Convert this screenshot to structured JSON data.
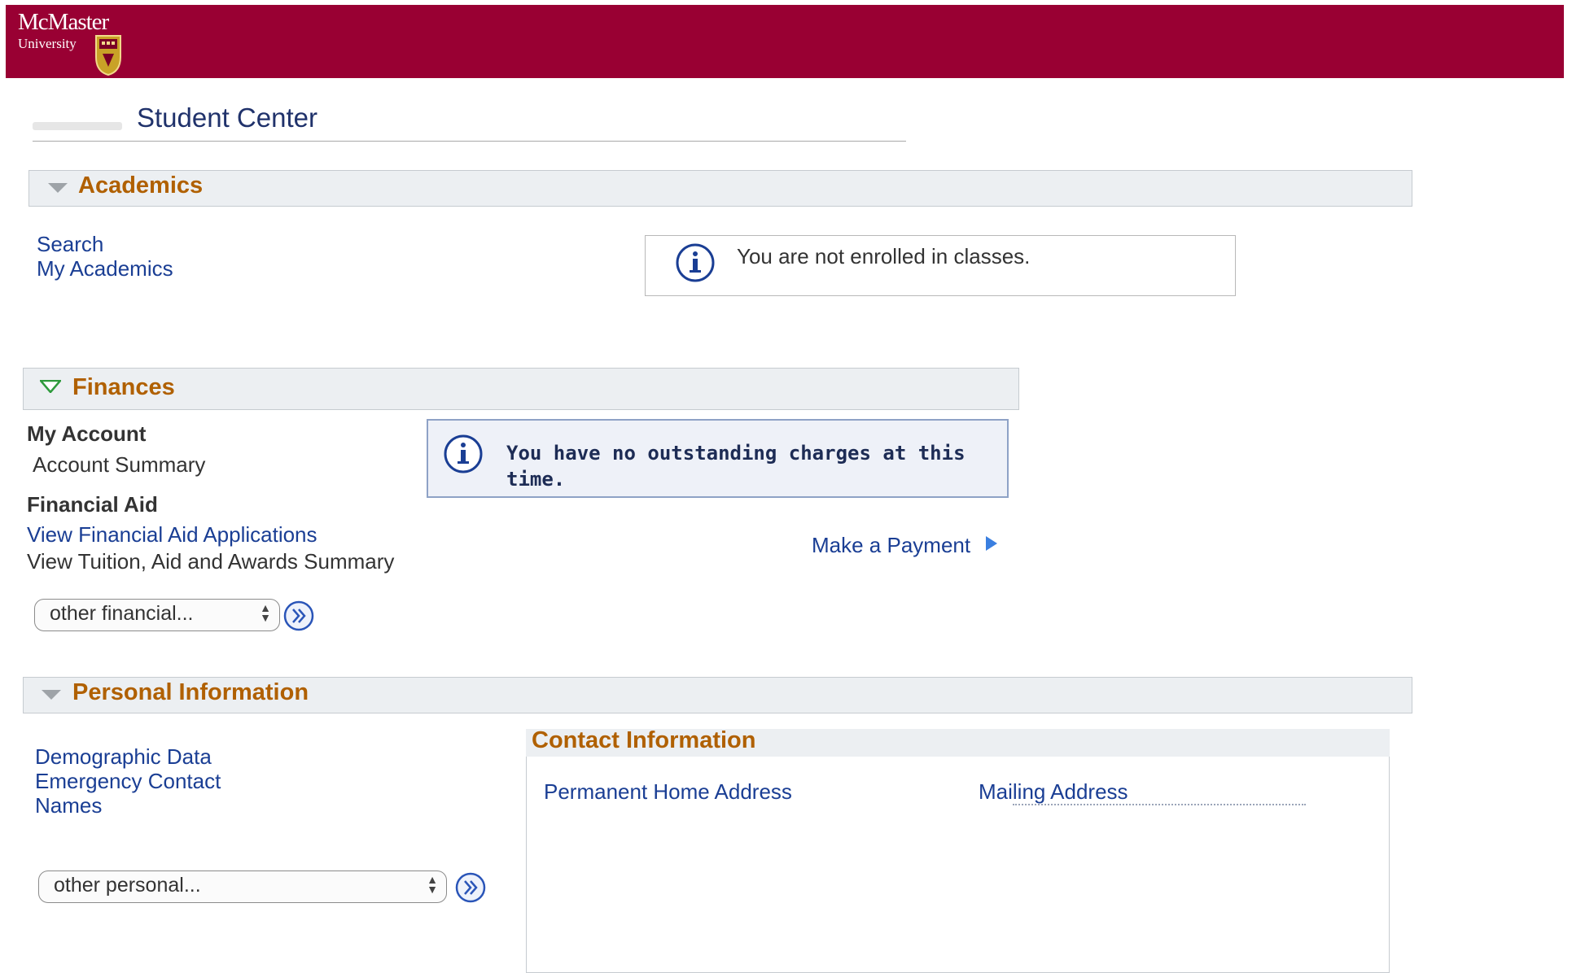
{
  "banner": {
    "logo_word": "McMaster",
    "logo_sub": "University",
    "brand_color": "#990033"
  },
  "page": {
    "title": "Student Center"
  },
  "academics": {
    "header": "Academics",
    "links": [
      "Search",
      "My Academics"
    ],
    "info_message": "You are not enrolled in classes."
  },
  "finances": {
    "header": "Finances",
    "my_account_heading": "My Account",
    "account_summary": "Account Summary",
    "financial_aid_heading": "Financial Aid",
    "view_fa_applications": "View Financial Aid Applications",
    "view_tuition_summary": "View Tuition, Aid and Awards Summary",
    "info_message": "You have no outstanding charges at this time.",
    "make_payment": "Make a Payment",
    "select_value": "other financial..."
  },
  "personal": {
    "header": "Personal Information",
    "links": [
      "Demographic Data",
      "Emergency Contact",
      "Names"
    ],
    "select_value": "other personal...",
    "contact": {
      "title": "Contact Information",
      "permanent_home_address": "Permanent Home Address",
      "mailing_address": "Mailing Address"
    }
  },
  "colors": {
    "section_label": "#b06000",
    "link": "#1a3e94",
    "section_bg": "#eceff2"
  },
  "icons": {
    "info": "info-circle-icon",
    "go": "double-chevron-right-icon",
    "collapse": "triangle-down-icon",
    "payment_arrow": "play-triangle-icon"
  }
}
